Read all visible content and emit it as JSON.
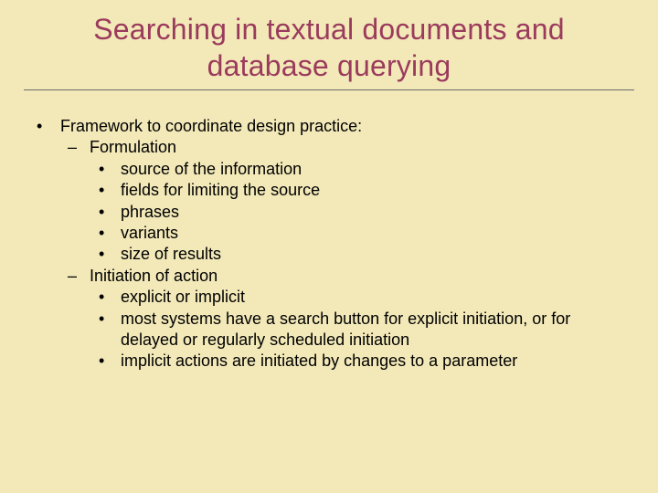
{
  "title": "Searching in textual documents and database querying",
  "bullet1": "•",
  "bullet2": "–",
  "bullet3": "•",
  "main": {
    "label": "Framework to coordinate design practice:",
    "sections": [
      {
        "label": "Formulation",
        "items": [
          "source of the information",
          "fields for limiting the source",
          "phrases",
          "variants",
          "size of results"
        ]
      },
      {
        "label": "Initiation of action",
        "items": [
          "explicit or implicit",
          "most systems have a search button for explicit initiation, or for delayed or regularly scheduled initiation",
          "implicit actions are initiated by changes to a parameter"
        ]
      }
    ]
  }
}
